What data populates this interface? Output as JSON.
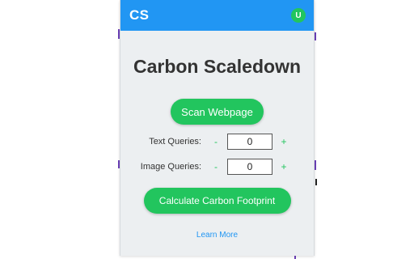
{
  "header": {
    "logo": "CS",
    "avatar_initial": "U"
  },
  "title": "Carbon Scaledown",
  "scan_button": "Scan Webpage",
  "text_queries": {
    "label": "Text Queries:",
    "minus": "-",
    "value": "0",
    "plus": "+"
  },
  "image_queries": {
    "label": "Image Queries:",
    "minus": "-",
    "value": "0",
    "plus": "+"
  },
  "calculate_button": "Calculate Carbon Footprint",
  "learn_more": "Learn More",
  "colors": {
    "header": "#2196f3",
    "accent_green": "#22c55e",
    "panel_bg": "#eceff1",
    "link": "#2196f3"
  }
}
